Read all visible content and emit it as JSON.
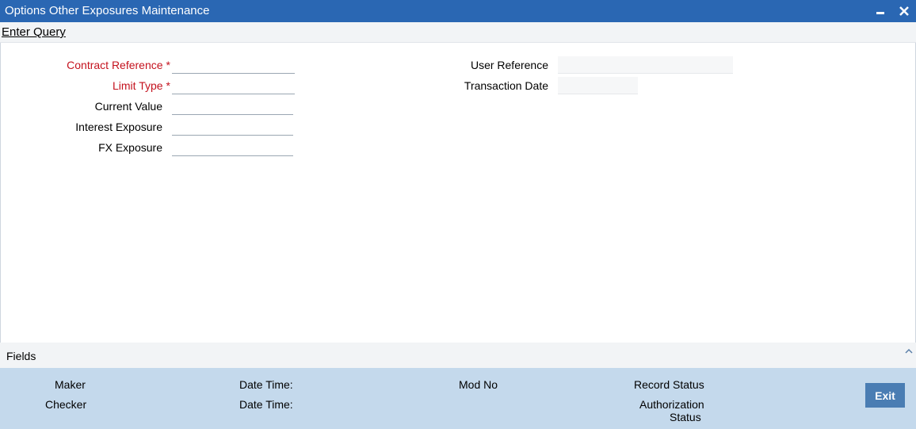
{
  "window": {
    "title": "Options Other Exposures Maintenance",
    "minimize_icon": "minimize-icon",
    "close_icon": "close-icon"
  },
  "menu": {
    "enter_query": "Enter Query"
  },
  "form": {
    "contract_reference": {
      "label": "Contract Reference",
      "required_mark": "*",
      "value": ""
    },
    "limit_type": {
      "label": "Limit Type",
      "required_mark": "*",
      "value": ""
    },
    "current_value": {
      "label": "Current Value",
      "value": ""
    },
    "interest_exposure": {
      "label": "Interest Exposure",
      "value": ""
    },
    "fx_exposure": {
      "label": "FX Exposure",
      "value": ""
    },
    "user_reference": {
      "label": "User Reference",
      "value": ""
    },
    "transaction_date": {
      "label": "Transaction Date",
      "value": ""
    }
  },
  "fields_bar": {
    "label": "Fields",
    "toggle_icon": "chevron-up-icon"
  },
  "audit": {
    "maker": "Maker",
    "maker_datetime": "Date Time:",
    "mod_no": "Mod No",
    "record_status": "Record Status",
    "checker": "Checker",
    "checker_datetime": "Date Time:",
    "authorization_line1": "Authorization",
    "authorization_line2": "Status"
  },
  "buttons": {
    "exit": "Exit"
  },
  "colors": {
    "titlebar": "#2a67b3",
    "required": "#c4121e",
    "audit_bg": "#c4d9ec",
    "exit_button": "#4a7db3"
  }
}
